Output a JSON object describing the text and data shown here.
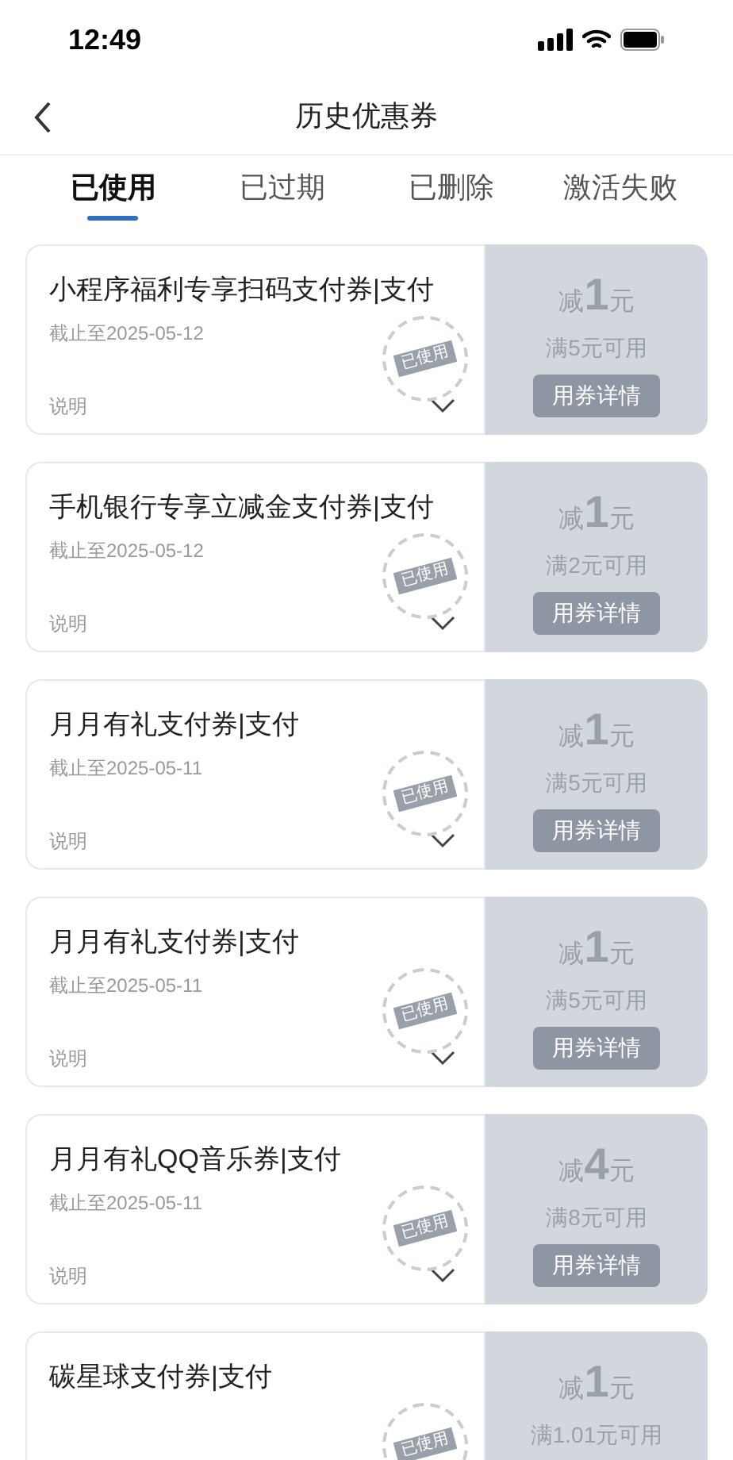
{
  "status_bar": {
    "time": "12:49"
  },
  "nav": {
    "title": "历史优惠券"
  },
  "tabs": [
    {
      "label": "已使用",
      "selected": true
    },
    {
      "label": "已过期",
      "selected": false
    },
    {
      "label": "已删除",
      "selected": false
    },
    {
      "label": "激活失败",
      "selected": false
    }
  ],
  "coupons": [
    {
      "title": "小程序福利专享扫码支付券|支付",
      "date": "截止至2025-05-12",
      "note": "说明",
      "stamp": "已使用",
      "prefix": "减",
      "amount": "1",
      "unit": "元",
      "condition": "满5元可用",
      "button": "用券详情"
    },
    {
      "title": "手机银行专享立减金支付券|支付",
      "date": "截止至2025-05-12",
      "note": "说明",
      "stamp": "已使用",
      "prefix": "减",
      "amount": "1",
      "unit": "元",
      "condition": "满2元可用",
      "button": "用券详情"
    },
    {
      "title": "月月有礼支付券|支付",
      "date": "截止至2025-05-11",
      "note": "说明",
      "stamp": "已使用",
      "prefix": "减",
      "amount": "1",
      "unit": "元",
      "condition": "满5元可用",
      "button": "用券详情"
    },
    {
      "title": "月月有礼支付券|支付",
      "date": "截止至2025-05-11",
      "note": "说明",
      "stamp": "已使用",
      "prefix": "减",
      "amount": "1",
      "unit": "元",
      "condition": "满5元可用",
      "button": "用券详情"
    },
    {
      "title": "月月有礼QQ音乐券|支付",
      "date": "截止至2025-05-11",
      "note": "说明",
      "stamp": "已使用",
      "prefix": "减",
      "amount": "4",
      "unit": "元",
      "condition": "满8元可用",
      "button": "用券详情"
    },
    {
      "title": "碳星球支付券|支付",
      "stamp": "已使用",
      "prefix": "减",
      "amount": "1",
      "unit": "元",
      "condition": "满1.01元可用"
    }
  ]
}
